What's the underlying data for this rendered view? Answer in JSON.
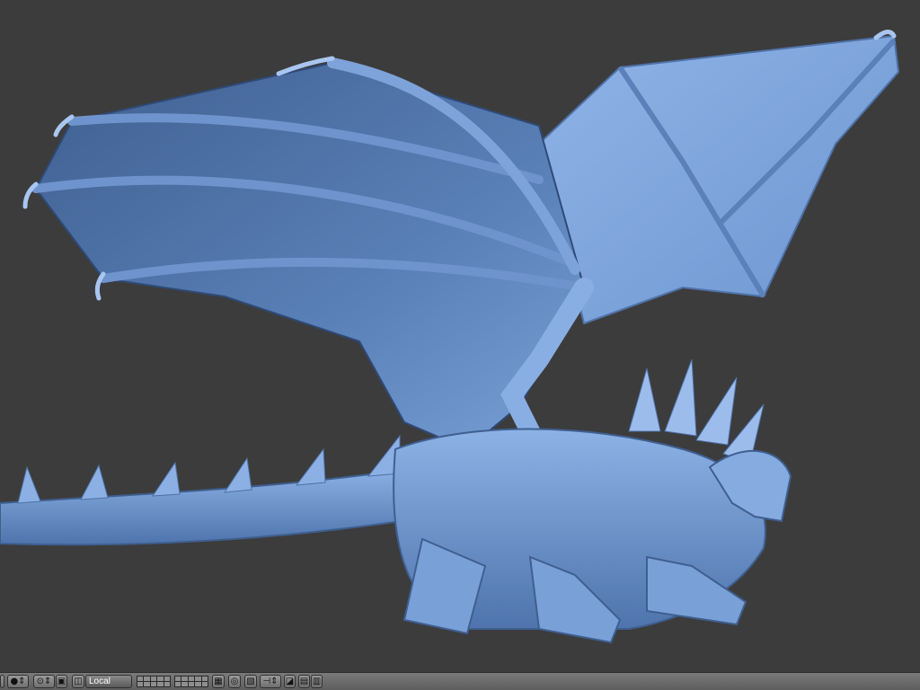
{
  "viewport": {
    "background": "#3c3c3c",
    "subject": "blue-sculpted-dragon",
    "model_color": "#6f98d6"
  },
  "header": {
    "pivot_select": {
      "value": "Local"
    },
    "icons": [
      "viewport-shading-icon",
      "pivot-point-icon",
      "proxy-icon",
      "orientation-icon",
      "layer-grid-a",
      "layer-grid-b",
      "lock-icon",
      "snap-icon",
      "manipulator-icon",
      "render-icon",
      "camera-icon"
    ]
  }
}
